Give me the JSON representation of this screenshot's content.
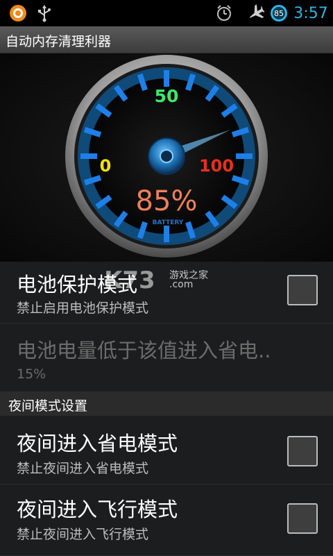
{
  "status_bar": {
    "time": "3:57",
    "battery_level": "85",
    "icons": [
      "avast-icon",
      "usb-icon",
      "alarm-clock-icon",
      "airplane-mode-icon",
      "battery-icon"
    ]
  },
  "app": {
    "title": "自动内存清理利器"
  },
  "gauge": {
    "label_min": "0",
    "label_mid": "50",
    "label_max": "100",
    "value_text": "85%",
    "battery_label": "BATTERY",
    "value": 85
  },
  "prefs": [
    {
      "title": "电池保护模式",
      "summary": "禁止启用电池保护模式",
      "checked": false,
      "enabled": true
    },
    {
      "title": "电池电量低于该值进入省电..",
      "summary": "15%",
      "enabled": false
    }
  ],
  "category": {
    "label": "夜间模式设置"
  },
  "night_prefs": [
    {
      "title": "夜间进入省电模式",
      "summary": "禁止夜间进入省电模式",
      "checked": false
    },
    {
      "title": "夜间进入飞行模式",
      "summary": "禁止夜间进入飞行模式",
      "checked": false
    }
  ],
  "watermark": {
    "brand": "K73",
    "cn": "游戏之家",
    "domain": ".com"
  },
  "colors": {
    "accent": "#33b5e5",
    "gauge_blue": "#1e7fe8",
    "label_min": "#f5e000",
    "label_mid": "#3ee86a",
    "label_max": "#e8301e",
    "value_text": "#f0805a"
  }
}
